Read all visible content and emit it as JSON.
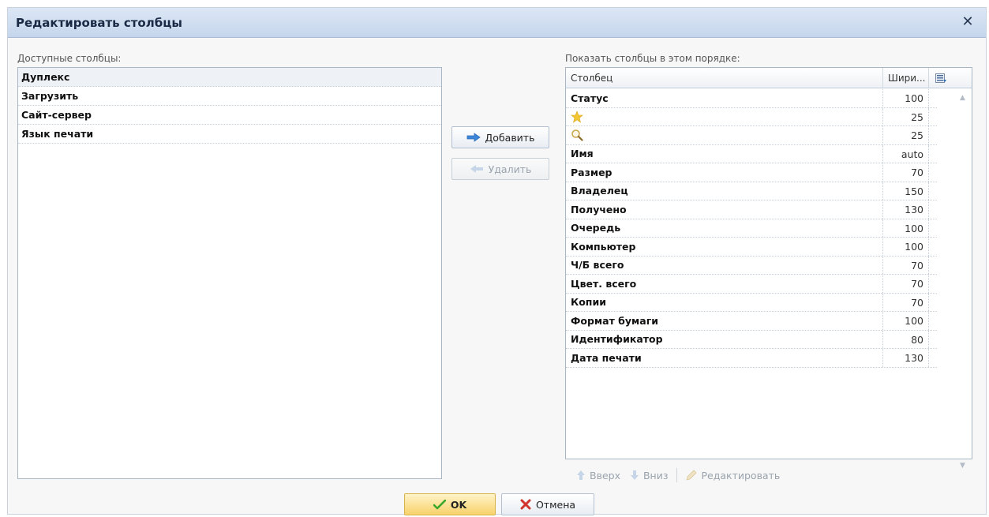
{
  "dialog": {
    "title": "Редактировать столбцы",
    "close_glyph": "✕"
  },
  "available": {
    "label": "Доступные столбцы:",
    "items": [
      "Дуплекс",
      "Загрузить",
      "Сайт-сервер",
      "Язык печати"
    ]
  },
  "actions": {
    "add_label": "Добавить",
    "remove_label": "Удалить"
  },
  "shown": {
    "label": "Показать столбцы в этом порядке:",
    "header_name": "Столбец",
    "header_width": "Шири...",
    "rows": [
      {
        "name": "Статус",
        "width": "100"
      },
      {
        "name": "",
        "icon": "star-icon",
        "width": "25"
      },
      {
        "name": "",
        "icon": "magnifier-icon",
        "width": "25"
      },
      {
        "name": "Имя",
        "width": "auto"
      },
      {
        "name": "Размер",
        "width": "70"
      },
      {
        "name": "Владелец",
        "width": "150"
      },
      {
        "name": "Получено",
        "width": "130"
      },
      {
        "name": "Очередь",
        "width": "100"
      },
      {
        "name": "Компьютер",
        "width": "100"
      },
      {
        "name": "Ч/Б всего",
        "width": "70"
      },
      {
        "name": "Цвет. всего",
        "width": "70"
      },
      {
        "name": "Копии",
        "width": "70"
      },
      {
        "name": "Формат бумаги",
        "width": "100"
      },
      {
        "name": "Идентификатор",
        "width": "80"
      },
      {
        "name": "Дата печати",
        "width": "130"
      }
    ]
  },
  "toolbar": {
    "up_label": "Вверх",
    "down_label": "Вниз",
    "edit_label": "Редактировать"
  },
  "footer": {
    "ok_label": "OK",
    "cancel_label": "Отмена"
  },
  "colors": {
    "accent_blue": "#3b86d8",
    "ok_check": "#3aa82a",
    "cancel_x": "#d0342c",
    "star": "#f2c633"
  }
}
